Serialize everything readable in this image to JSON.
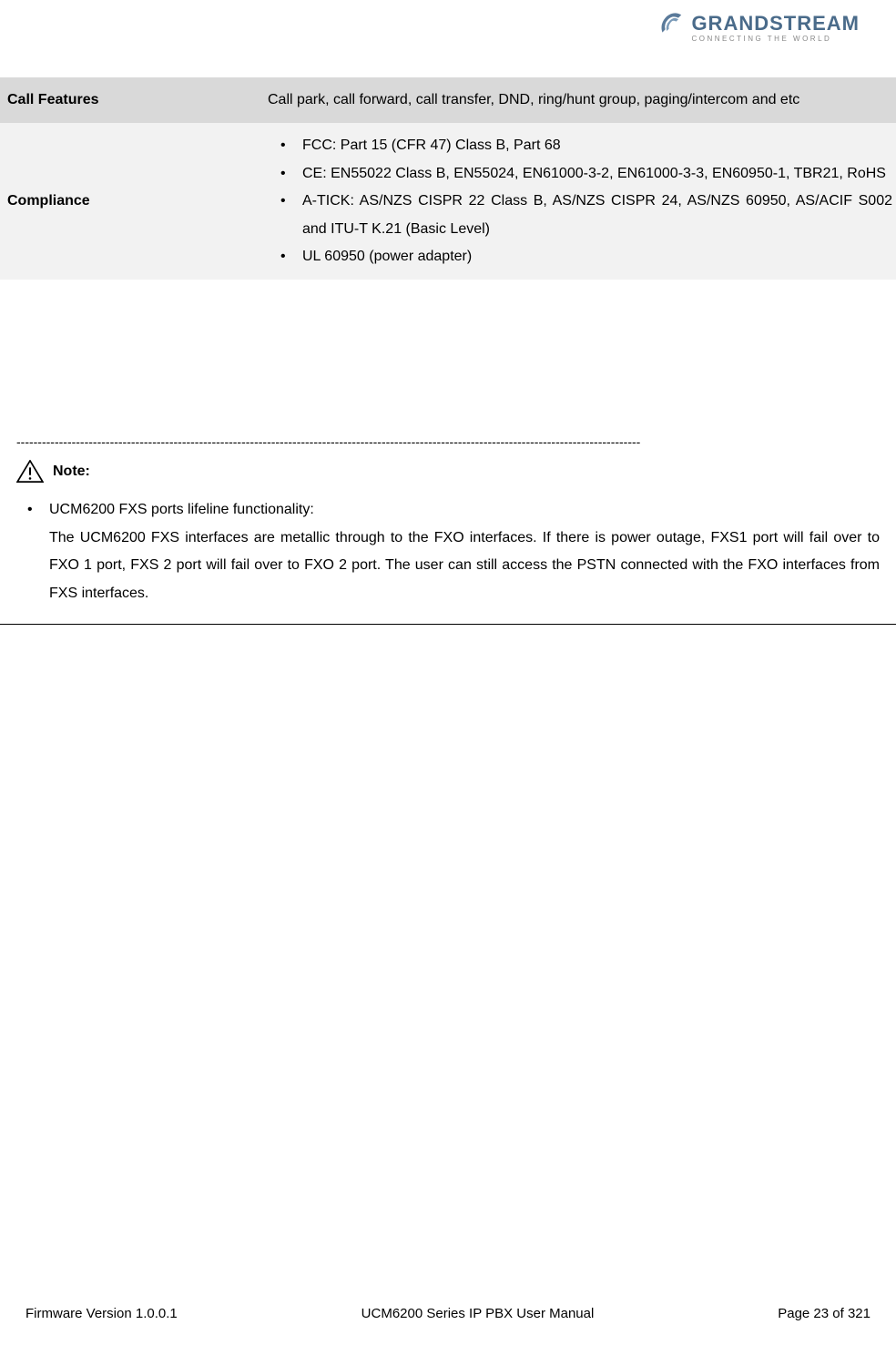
{
  "header": {
    "brand_name": "GRANDSTREAM",
    "tagline": "CONNECTING THE WORLD"
  },
  "table": {
    "rows": [
      {
        "label": "Call Features",
        "value": "Call park, call forward, call transfer, DND, ring/hunt group, paging/intercom and etc"
      },
      {
        "label": "Compliance",
        "bullets": [
          "FCC: Part 15 (CFR 47) Class B, Part 68",
          "CE: EN55022 Class B, EN55024, EN61000-3-2, EN61000-3-3, EN60950-1, TBR21, RoHS",
          "A-TICK: AS/NZS CISPR 22 Class B, AS/NZS CISPR 24, AS/NZS 60950, AS/ACIF S002 and ITU-T K.21 (Basic Level)",
          "UL 60950 (power adapter)"
        ]
      }
    ]
  },
  "note": {
    "label": "Note:",
    "items": [
      {
        "title": "UCM6200 FXS ports lifeline functionality:",
        "body": "The UCM6200 FXS interfaces are metallic through to the FXO interfaces. If there is power outage, FXS1 port will fail over to FXO 1 port, FXS 2 port will fail over to FXO 2 port. The user can still access the PSTN connected with the FXO interfaces from FXS interfaces."
      }
    ]
  },
  "footer": {
    "left": "Firmware Version 1.0.0.1",
    "center": "UCM6200 Series IP PBX User Manual",
    "right": "Page 23 of 321"
  }
}
